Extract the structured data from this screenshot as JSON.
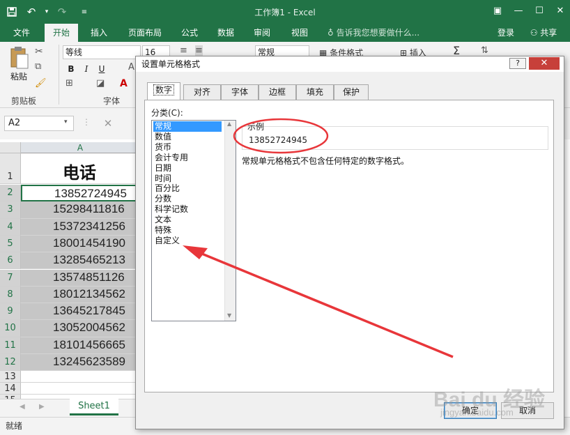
{
  "app": {
    "window_title": "工作簿1 - Excel"
  },
  "ribbon": {
    "tabs": [
      "文件",
      "开始",
      "插入",
      "页面布局",
      "公式",
      "数据",
      "审阅",
      "视图"
    ],
    "tell_me": "告诉我您想要做什么...",
    "login": "登录",
    "share": "共享",
    "font_name": "等线",
    "font_size": "16",
    "number_format": "常规",
    "paste_label": "粘贴",
    "clipboard_group": "剪贴板",
    "font_group": "字体",
    "bold": "B",
    "italic": "I",
    "underline": "U",
    "conditional_format": "条件格式",
    "insert": "插入"
  },
  "formula_bar": {
    "name_box": "A2"
  },
  "sheet": {
    "column_header": "A",
    "header_row_number": "1",
    "header_value": "电话",
    "rows": [
      {
        "num": "2",
        "value": "13852724945"
      },
      {
        "num": "3",
        "value": "15298411816"
      },
      {
        "num": "4",
        "value": "15372341256"
      },
      {
        "num": "5",
        "value": "18001454190"
      },
      {
        "num": "6",
        "value": "13285465213"
      },
      {
        "num": "7",
        "value": "13574851126"
      },
      {
        "num": "8",
        "value": "18012134562"
      },
      {
        "num": "9",
        "value": "13645217845"
      },
      {
        "num": "10",
        "value": "13052004562"
      },
      {
        "num": "11",
        "value": "18101456665"
      },
      {
        "num": "12",
        "value": "13245623589"
      }
    ],
    "empty_rows": [
      "13",
      "14",
      "15"
    ],
    "sheet_tab": "Sheet1",
    "status": "就绪"
  },
  "dialog": {
    "title": "设置单元格格式",
    "help": "?",
    "tabs": [
      "数字",
      "对齐",
      "字体",
      "边框",
      "填充",
      "保护"
    ],
    "category_label": "分类(C):",
    "categories": [
      "常规",
      "数值",
      "货币",
      "会计专用",
      "日期",
      "时间",
      "百分比",
      "分数",
      "科学记数",
      "文本",
      "特殊",
      "自定义"
    ],
    "sample_label": "示例",
    "sample_value": "13852724945",
    "description": "常规单元格格式不包含任何特定的数字格式。",
    "ok": "确定",
    "cancel": "取消"
  },
  "watermark": {
    "main": "Bai du 经验",
    "sub": "jingyan.baidu.com"
  },
  "colors": {
    "excel_green": "#217346",
    "annotation_red": "#e8363a",
    "selection_blue": "#3399ff"
  }
}
